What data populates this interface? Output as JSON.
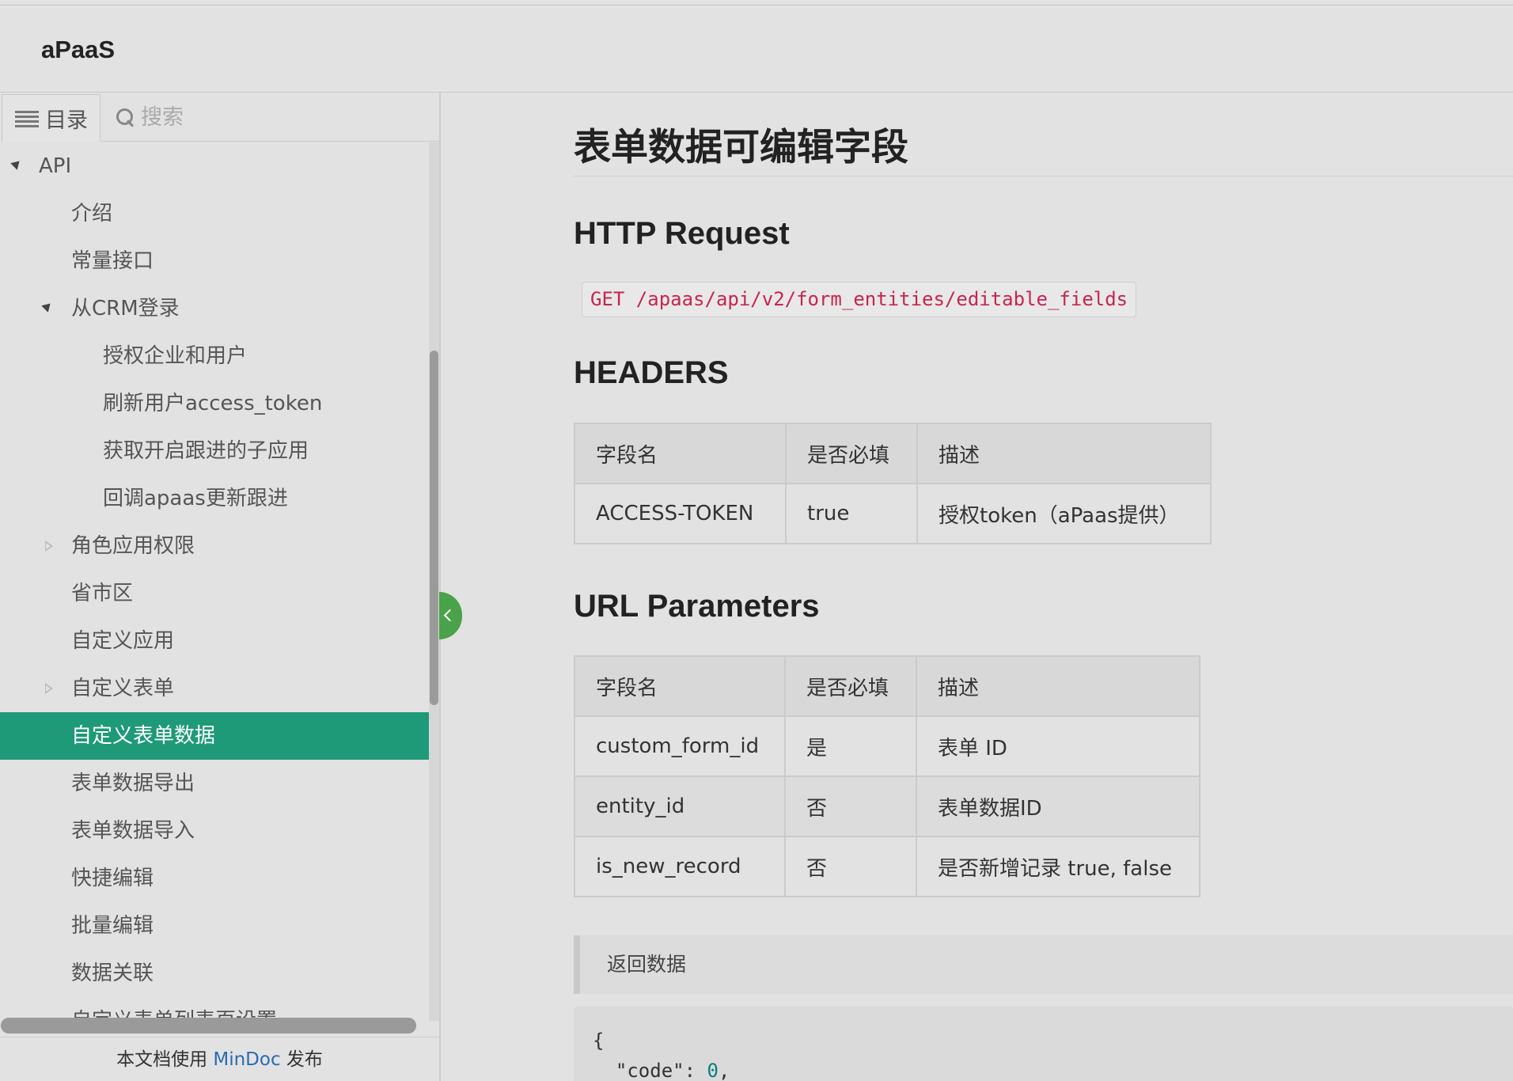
{
  "header": {
    "brand": "aPaaS"
  },
  "sidebar": {
    "tab_toc": "目录",
    "search_placeholder": "搜索",
    "items": [
      {
        "label": "API",
        "level": 0,
        "expanded": true
      },
      {
        "label": "介绍",
        "level": 1
      },
      {
        "label": "常量接口",
        "level": 1
      },
      {
        "label": "从CRM登录",
        "level": 1,
        "expanded": true
      },
      {
        "label": "授权企业和用户",
        "level": 2
      },
      {
        "label": "刷新用户access_token",
        "level": 2
      },
      {
        "label": "获取开启跟进的子应用",
        "level": 2
      },
      {
        "label": "回调apaas更新跟进",
        "level": 2
      },
      {
        "label": "角色应用权限",
        "level": 1,
        "expanded": false
      },
      {
        "label": "省市区",
        "level": 1
      },
      {
        "label": "自定义应用",
        "level": 1
      },
      {
        "label": "自定义表单",
        "level": 1,
        "expanded": false
      },
      {
        "label": "自定义表单数据",
        "level": 1,
        "active": true
      },
      {
        "label": "表单数据导出",
        "level": 1
      },
      {
        "label": "表单数据导入",
        "level": 1
      },
      {
        "label": "快捷编辑",
        "level": 1
      },
      {
        "label": "批量编辑",
        "level": 1
      },
      {
        "label": "数据关联",
        "level": 1
      },
      {
        "label": "自定义表单列表页设置",
        "level": 1
      }
    ],
    "footer": {
      "prefix": "本文档使用 ",
      "link": "MinDoc",
      "suffix": " 发布"
    }
  },
  "main": {
    "title": "表单数据可编辑字段",
    "http_request_heading": "HTTP Request",
    "endpoint": "GET /apaas/api/v2/form_entities/editable_fields",
    "headers_heading": "HEADERS",
    "headers_table": {
      "columns": [
        "字段名",
        "是否必填",
        "描述"
      ],
      "rows": [
        [
          "ACCESS-TOKEN",
          "true",
          "授权token（aPaas提供）"
        ]
      ]
    },
    "url_params_heading": "URL Parameters",
    "url_params_table": {
      "columns": [
        "字段名",
        "是否必填",
        "描述"
      ],
      "rows": [
        [
          "custom_form_id",
          "是",
          "表单 ID"
        ],
        [
          "entity_id",
          "否",
          "表单数据ID"
        ],
        [
          "is_new_record",
          "否",
          "是否新增记录 true, false"
        ]
      ]
    },
    "return_label": "返回数据",
    "code_lines": [
      "{",
      "  \"code\": ",
      "0",
      ","
    ]
  },
  "colors": {
    "active_item": "#1e9a78",
    "collapse_button": "#4aa24a",
    "code_text": "#c7254e",
    "link": "#2a6cb0"
  }
}
